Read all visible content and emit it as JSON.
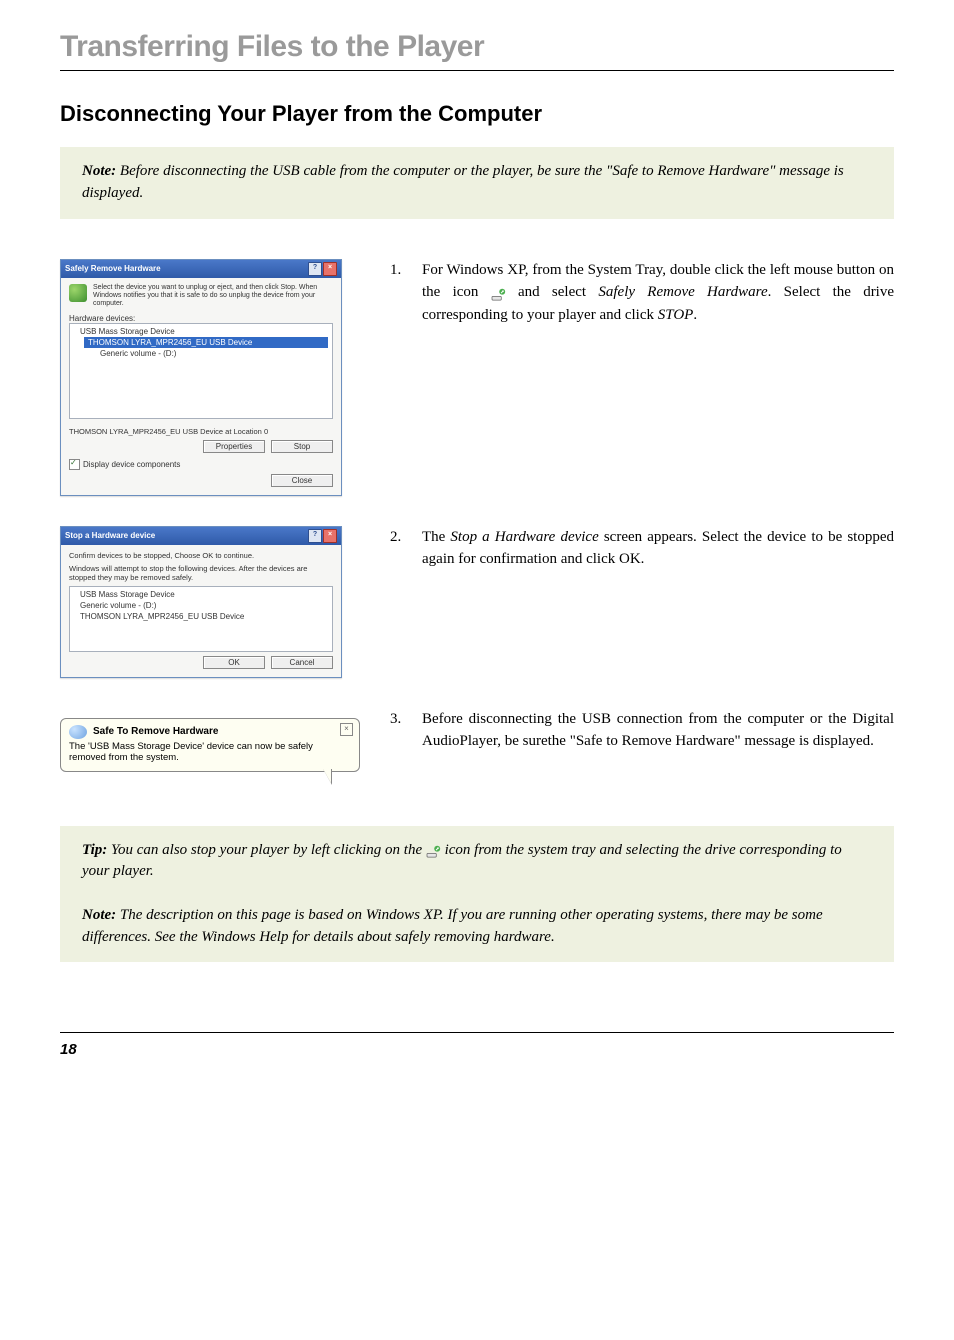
{
  "chapter_title": "Transferring Files to the Player",
  "section_title": "Disconnecting Your Player from the Computer",
  "note1": {
    "label": "Note:",
    "body": " Before disconnecting the USB cable from the computer or the player, be sure the \"Safe to Remove Hardware\" message is displayed."
  },
  "steps": [
    {
      "num": "1.",
      "pre": "For Windows XP, from the System Tray, double click the left mouse button on the icon  ",
      "post": "  and select ",
      "italic1": "Safely Remove Hardware",
      "mid2": ". Select the drive corresponding to your player and click ",
      "italic2": "STOP",
      "tail": "."
    },
    {
      "num": "2.",
      "pre": "The ",
      "italic1": "Stop a Hardware device",
      "post": " screen appears. Select the device to be stopped again for confirmation and click OK."
    },
    {
      "num": "3.",
      "pre": "Before disconnecting the USB connection from the computer or the Digital AudioPlayer, be surethe \"Safe to Remove Hardware\" message is displayed."
    }
  ],
  "dialog1": {
    "title": "Safely Remove Hardware",
    "intro": "Select the device you want to unplug or eject, and then click Stop. When Windows notifies you that it is safe to do so unplug the device from your computer.",
    "list_label": "Hardware devices:",
    "items": [
      "USB Mass Storage Device",
      "THOMSON LYRA_MPR2456_EU USB Device",
      "Generic volume - (D:)"
    ],
    "status": "THOMSON LYRA_MPR2456_EU USB Device at Location 0",
    "btn_props": "Properties",
    "btn_stop": "Stop",
    "chk_label": "Display device components",
    "btn_close": "Close"
  },
  "dialog2": {
    "title": "Stop a Hardware device",
    "line1": "Confirm devices to be stopped, Choose OK to continue.",
    "line2": "Windows will attempt to stop the following devices. After the devices are stopped they may be removed safely.",
    "items": [
      "USB Mass Storage Device",
      "Generic volume - (D:)",
      "THOMSON LYRA_MPR2456_EU USB Device"
    ],
    "btn_ok": "OK",
    "btn_cancel": "Cancel"
  },
  "balloon": {
    "title": "Safe To Remove Hardware",
    "body": "The 'USB Mass Storage Device' device can now be safely removed from the system."
  },
  "tip": {
    "label": "Tip:",
    "pre": " You can also stop your player by left clicking on the ",
    "post": " icon from the system tray and selecting the drive corresponding to your player."
  },
  "note2": {
    "label": "Note:",
    "body": " The description on this page is based on Windows XP. If you are running other operating systems, there may be some differences. See the Windows Help for details about safely removing hardware."
  },
  "page_number": "18"
}
